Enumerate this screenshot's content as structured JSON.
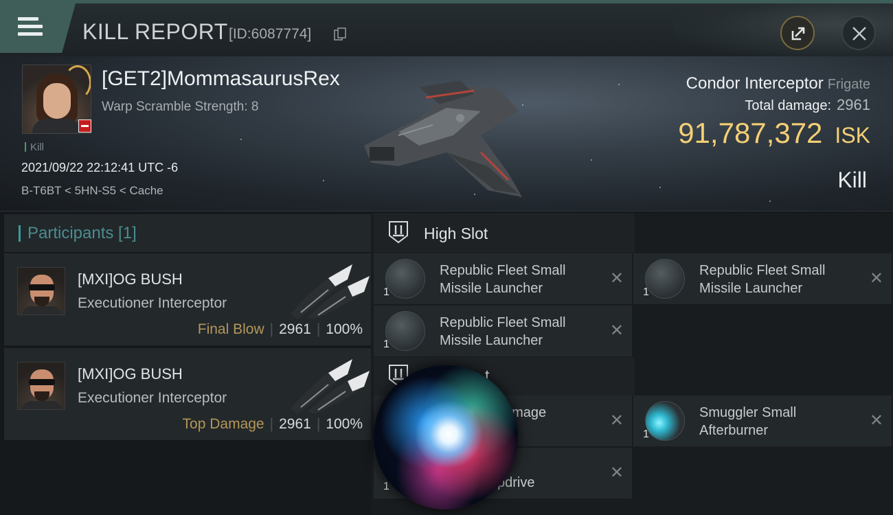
{
  "header": {
    "title": "KILL REPORT",
    "report_id": "[ID:6087774]",
    "menu_icon": "hamburger-menu-icon",
    "share_icon": "share-external-icon",
    "close_icon": "close-icon"
  },
  "victim": {
    "name": "[GET2]MommasaurusRex",
    "warp_scramble": "Warp Scramble Strength: 8",
    "kill_tag": "Kill",
    "timestamp": "2021/09/22 22:12:41 UTC -6",
    "location": "B-T6BT < 5HN-S5 < Cache",
    "ship_name": "Condor Interceptor",
    "ship_class": "Frigate",
    "total_damage_label": "Total damage:",
    "total_damage": "2961",
    "isk_value": "91,787,372",
    "isk_unit": "ISK",
    "result": "Kill"
  },
  "participants": {
    "title": "Participants [1]",
    "rows": [
      {
        "name": "[MXI]OG BUSH",
        "ship": "Executioner Interceptor",
        "tag": "Final Blow",
        "damage": "2961",
        "percent": "100%"
      },
      {
        "name": "[MXI]OG BUSH",
        "ship": "Executioner Interceptor",
        "tag": "Top Damage",
        "damage": "2961",
        "percent": "100%"
      }
    ]
  },
  "fitting": {
    "high_slot_title": "High Slot",
    "modules": [
      {
        "qty": "1",
        "name_line1": "Republic Fleet Small",
        "name_line2": "Missile Launcher"
      },
      {
        "qty": "1",
        "name_line1": "Republic Fleet Small",
        "name_line2": "Missile Launcher"
      },
      {
        "qty": "1",
        "name_line1": "Republic Fleet Small",
        "name_line2": "Missile Launcher"
      }
    ],
    "mid_slot_partial": "t",
    "mid_modules": [
      {
        "qty": "",
        "name_partial": "amage"
      },
      {
        "qty": "1",
        "name_line1": "Smuggler Small",
        "name_line2": "Afterburner"
      },
      {
        "qty": "1",
        "name_partial": "pdrive"
      }
    ],
    "remove_symbol": "✕"
  },
  "colors": {
    "accent_teal": "#3f5e5a",
    "isk_gold": "#f4cf75",
    "tag_gold": "#b49758",
    "standing_red": "#c61d1d"
  }
}
